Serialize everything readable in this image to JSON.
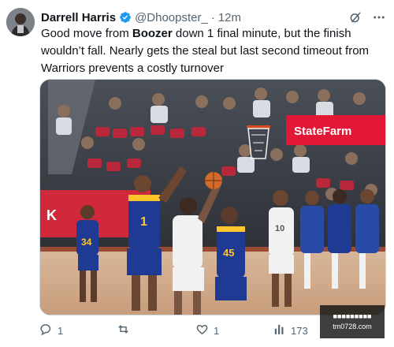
{
  "tweet": {
    "display_name": "Darrell Harris",
    "handle": "@Dhoopster_",
    "separator": "·",
    "time": "12m",
    "text_before": "Good move from ",
    "text_bold": "Boozer",
    "text_after": " down 1 final minute, but the finish wouldn’t fall. Nearly gets the steal but last second timeout from Warriors prevents a costly turnover"
  },
  "media": {
    "banner_text": "StateFarm",
    "jersey_left": "1",
    "jersey_center": "45",
    "jersey_far_left": "34",
    "jersey_right": "10"
  },
  "actions": {
    "reply_count": "1",
    "repost_count": "",
    "like_count": "1",
    "view_count": "173"
  },
  "watermark": {
    "line1": "■■■■■■■■■",
    "line2": "tm0728.com"
  },
  "colors": {
    "verified": "#1d9bf0",
    "muted": "#536471",
    "text": "#0f1419",
    "statefarm_red": "#e31837"
  }
}
